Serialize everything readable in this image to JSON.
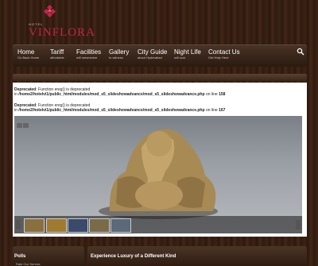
{
  "logo": {
    "hotel_label": "HOTEL",
    "brand_name": "VINFLORA"
  },
  "nav": {
    "items": [
      {
        "title": "Home",
        "subtitle": "Go Back Home"
      },
      {
        "title": "Tariff",
        "subtitle": "affordable"
      },
      {
        "title": "Facilities",
        "subtitle": "will mesmerize"
      },
      {
        "title": "Gallery",
        "subtitle": "to witness"
      },
      {
        "title": "City Guide",
        "subtitle": "about Hyderabad"
      },
      {
        "title": "Night Life",
        "subtitle": "will rock"
      },
      {
        "title": "Contact Us",
        "subtitle": "Get Help Here"
      }
    ],
    "search_icon": "search-icon"
  },
  "warnings": [
    {
      "label": "Deprecated",
      "message": ": Function ereg() is deprecated",
      "path_prefix": "in",
      "path": "/home2/hotelvi1/public_html/modules/mod_s5_slideshowadvance/mod_s5_slideshowadvance.php",
      "line_prefix": "on line",
      "line": "158"
    },
    {
      "label": "Deprecated",
      "message": ": Function ereg() is deprecated",
      "path_prefix": "in",
      "path": "/home2/hotelvi1/public_html/modules/mod_s5_slideshowadvance/mod_s5_slideshowadvance.php",
      "line_prefix": "on line",
      "line": "167"
    }
  ],
  "bottom": {
    "left_title": "Polls",
    "left_sub": "Rate Our Service",
    "right_title": "Experience Luxury of a Different Kind"
  },
  "colors": {
    "brand": "#c0254a",
    "nav_bg": "#3a2618",
    "panel_bg": "#ffffff"
  }
}
